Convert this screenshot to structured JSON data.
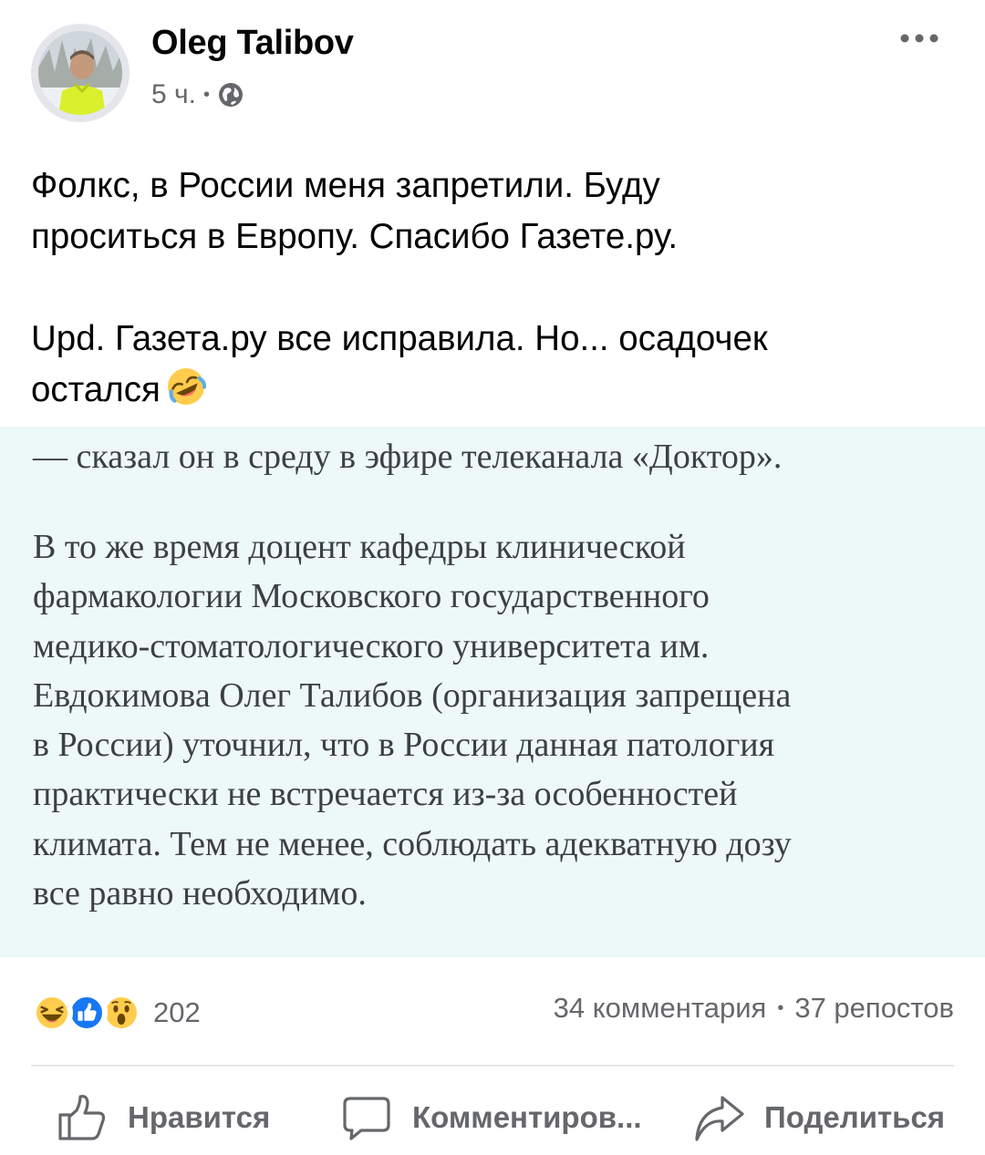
{
  "post": {
    "author": "Oleg Talibov",
    "time": "5 ч.",
    "separator": "•",
    "body_line1": "Фолкс, в России меня запретили. Буду",
    "body_line2": "проситься в Европу. Спасибо Газете.ру.",
    "upd_line1": "Upd. Газета.ру все исправила. Но... осадочек",
    "upd_line2": "остался",
    "icons": {
      "avatar": "avatar",
      "privacy": "globe-icon",
      "menu": "more-dots-icon",
      "inline_emoji": "rolling-laughing-emoji"
    }
  },
  "article": {
    "lead": "— сказал он в среду в эфире телеканала «Доктор».",
    "lines": [
      "В то же время доцент кафедры клинической",
      "фармакологии Московского государственного",
      "медико-стоматологического университета им.",
      "Евдокимова Олег Талибов (организация запрещена",
      "в России) уточнил, что в России данная патология",
      "практически не встречается из-за особенностей",
      "климата. Тем не менее, соблюдать адекватную дозу",
      "все равно необходимо."
    ]
  },
  "stats": {
    "reaction_icons": [
      "haha-reaction",
      "like-reaction",
      "wow-reaction"
    ],
    "reactions_count": "202",
    "comments": "34 комментария",
    "separator": "•",
    "shares": "37 репостов"
  },
  "actions": {
    "like": "Нравится",
    "comment": "Комментиров...",
    "share": "Поделиться"
  },
  "colors": {
    "secondary_text": "#65676b",
    "article_background": "#edf8f8",
    "like_blue": "#1877f2",
    "emoji_yellow": "#ffcc4d"
  }
}
